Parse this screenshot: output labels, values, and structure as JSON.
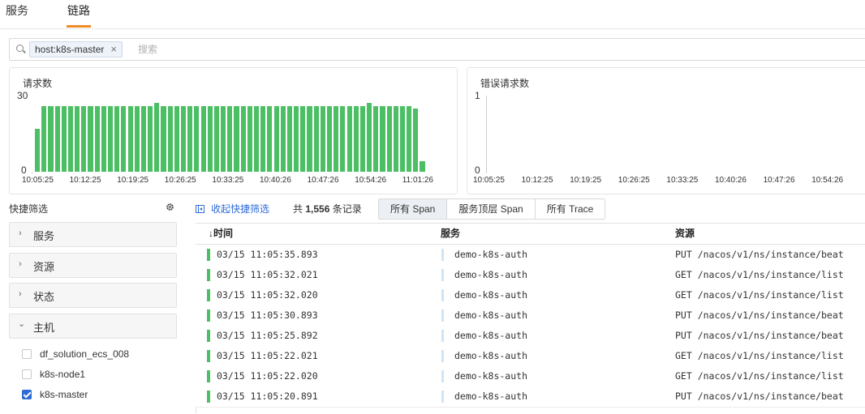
{
  "tabs": [
    {
      "label": "服务",
      "active": false
    },
    {
      "label": "链路",
      "active": true
    }
  ],
  "accent_color": "#f08a24",
  "search": {
    "chip": "host:k8s-master",
    "chip_close": "×",
    "placeholder": "搜索"
  },
  "charts": {
    "requests": {
      "title": "请求数",
      "ymax_label": "30",
      "ymin_label": "0",
      "color": "#4cbf64"
    },
    "errors": {
      "title": "错误请求数",
      "ymax_label": "1",
      "ymin_label": "0"
    }
  },
  "chart_data": [
    {
      "type": "bar",
      "title": "请求数",
      "ylim": [
        0,
        30
      ],
      "xticks": [
        "10:05:25",
        "10:12:25",
        "10:19:25",
        "10:26:25",
        "10:33:25",
        "10:40:26",
        "10:47:26",
        "10:54:26",
        "11:01:26"
      ],
      "values": [
        17,
        26,
        26,
        26,
        26,
        26,
        26,
        26,
        26,
        26,
        26,
        26,
        26,
        26,
        26,
        26,
        26,
        26,
        27,
        26,
        26,
        26,
        26,
        26,
        26,
        26,
        26,
        26,
        26,
        26,
        26,
        26,
        26,
        26,
        26,
        26,
        26,
        26,
        26,
        26,
        26,
        26,
        26,
        26,
        26,
        26,
        26,
        26,
        26,
        26,
        27,
        26,
        26,
        26,
        26,
        26,
        26,
        25,
        4
      ]
    },
    {
      "type": "bar",
      "title": "错误请求数",
      "ylim": [
        0,
        1
      ],
      "xticks": [
        "10:05:25",
        "10:12:25",
        "10:19:25",
        "10:26:25",
        "10:33:25",
        "10:40:26",
        "10:47:26",
        "10:54:26"
      ],
      "values": []
    }
  ],
  "quick_filter": {
    "title": "快捷筛选",
    "sections": [
      {
        "label": "服务",
        "expanded": false
      },
      {
        "label": "资源",
        "expanded": false
      },
      {
        "label": "状态",
        "expanded": false
      },
      {
        "label": "主机",
        "expanded": true
      }
    ],
    "hosts": [
      {
        "label": "df_solution_ecs_008",
        "checked": false
      },
      {
        "label": "k8s-node1",
        "checked": false
      },
      {
        "label": "k8s-master",
        "checked": true
      }
    ]
  },
  "toolbar": {
    "collapse_label": "收起快捷筛选",
    "count_prefix": "共 ",
    "count_value": "1,556",
    "count_suffix": " 条记录",
    "segments": [
      {
        "label": "所有 Span",
        "active": true
      },
      {
        "label": "服务顶层 Span",
        "active": false
      },
      {
        "label": "所有 Trace",
        "active": false
      }
    ]
  },
  "table": {
    "headers": {
      "time": "↓时间",
      "service": "服务",
      "resource": "资源"
    },
    "rows": [
      {
        "time": "03/15 11:05:35.893",
        "service": "demo-k8s-auth",
        "resource": "PUT /nacos/v1/ns/instance/beat"
      },
      {
        "time": "03/15 11:05:32.021",
        "service": "demo-k8s-auth",
        "resource": "GET /nacos/v1/ns/instance/list"
      },
      {
        "time": "03/15 11:05:32.020",
        "service": "demo-k8s-auth",
        "resource": "GET /nacos/v1/ns/instance/list"
      },
      {
        "time": "03/15 11:05:30.893",
        "service": "demo-k8s-auth",
        "resource": "PUT /nacos/v1/ns/instance/beat"
      },
      {
        "time": "03/15 11:05:25.892",
        "service": "demo-k8s-auth",
        "resource": "PUT /nacos/v1/ns/instance/beat"
      },
      {
        "time": "03/15 11:05:22.021",
        "service": "demo-k8s-auth",
        "resource": "GET /nacos/v1/ns/instance/list"
      },
      {
        "time": "03/15 11:05:22.020",
        "service": "demo-k8s-auth",
        "resource": "GET /nacos/v1/ns/instance/list"
      },
      {
        "time": "03/15 11:05:20.891",
        "service": "demo-k8s-auth",
        "resource": "PUT /nacos/v1/ns/instance/beat"
      }
    ]
  }
}
